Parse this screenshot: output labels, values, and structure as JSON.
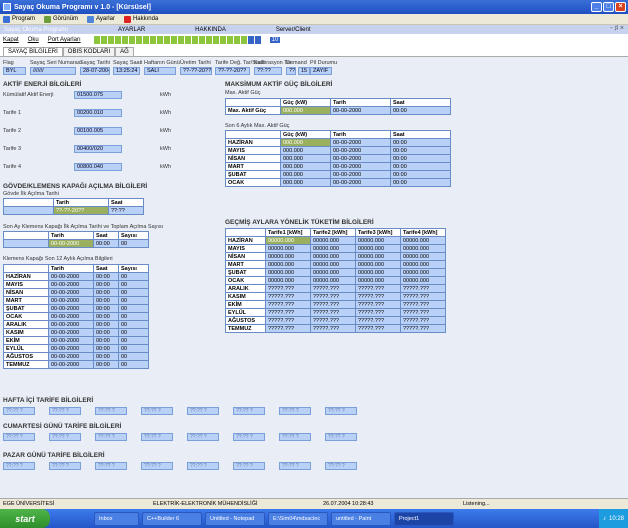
{
  "window": {
    "title": "Sayaç Okuma Programı v 1.0 - [Kürsüsel]"
  },
  "menu": [
    "Program",
    "Görünüm",
    "Ayarlar",
    "Hakkında"
  ],
  "mdi": {
    "child_title": "Sayaç Okuma Programı",
    "items": [
      "AYARLAR",
      "HAKKINDA",
      "Server/Client"
    ],
    "controls": "- ♯ ×"
  },
  "toolbar": {
    "kapat": "Kapat",
    "oku": "Oku",
    "port": "Port Ayarları",
    "progress_label": "10"
  },
  "tabs": [
    "SAYAÇ BİLGİLERİ",
    "OBIS KODLARI",
    "AĞ"
  ],
  "info": {
    "labels": [
      "Flag",
      "Sayaç Seri Numarası",
      "Sayaç Tarihi",
      "Sayaç Saati",
      "Haftanın Günü",
      "Üretim Tarihi",
      "Tarife Değ. Tar/Saati",
      "Kalibrasyon Tar.",
      "Demand",
      "Pil Durumu"
    ],
    "values": [
      "BYL",
      "///////",
      "28-07-2004",
      "13:25:24",
      "SALI",
      "??-??-20??",
      "??-??-20??",
      "??:??",
      "??-??-20??",
      "15",
      "ZAYIF"
    ],
    "dk": "DK"
  },
  "aktif": {
    "title": "AKTİF ENERJİ BİLGİLERİ",
    "rows": [
      {
        "label": "Kümülatif Aktif Enerji",
        "value": "01500.075",
        "unit": "kWh"
      },
      {
        "label": "Tarife 1",
        "value": "00200.010",
        "unit": "kWh"
      },
      {
        "label": "Tarife 2",
        "value": "00100.005",
        "unit": "kWh"
      },
      {
        "label": "Tarife 3",
        "value": "00400/020",
        "unit": "kWh"
      },
      {
        "label": "Tarife 4",
        "value": "00800.040",
        "unit": "kWh"
      }
    ]
  },
  "govde": {
    "title": "GÖVDE/KLEMENS KAPAĞI AÇILMA BİLGİLERİ",
    "sub1": "Gövde İlk Açılma Tarihi",
    "head1": [
      "Tarih",
      "Saat"
    ],
    "row1": [
      "??-??-20??",
      "??:??"
    ],
    "sub2": "Son Ay Klemens Kapağı İlk Açılma Tarihi ve Toplam Açılma Sayısı",
    "head2": [
      "Tarih",
      "Saat",
      "Sayısı"
    ],
    "row2": [
      "00-00-2000",
      "00:00",
      "00"
    ],
    "sub3": "Klemens Kapağı Son 12 Aylık Açılma Bilgileri",
    "head3": [
      "Tarih",
      "Saat",
      "Sayısı"
    ],
    "months": [
      "HAZİRAN",
      "MAYIS",
      "NİSAN",
      "MART",
      "ŞUBAT",
      "OCAK",
      "ARALIK",
      "KASIM",
      "EKİM",
      "EYLÜL",
      "AĞUSTOS",
      "TEMMUZ"
    ],
    "cells": [
      "00-00-2000",
      "00:00",
      "00"
    ]
  },
  "maks": {
    "title": "MAKSİMUM AKTİF GÜÇ BİLGİLERİ",
    "sub1": "Max. Aktif Güç",
    "head": [
      "Güç (kW)",
      "Tarih",
      "Saat"
    ],
    "row1": {
      "label": "Max. Aktif Güç",
      "values": [
        "000.000",
        "00-00-2000",
        "00:00"
      ]
    },
    "sub2": "Son 6 Aylık Max. Aktif Güç",
    "months": [
      "HAZİRAN",
      "MAYIS",
      "NİSAN",
      "MART",
      "ŞUBAT",
      "OCAK"
    ],
    "cells": [
      "000.000",
      "00-00-2000",
      "00:00"
    ]
  },
  "gecmis": {
    "title": "GEÇMİŞ AYLARA YÖNELİK TÜKETİM BİLGİLERİ",
    "head": [
      "Tarife1 [kWh]",
      "Tarife2 [kWh]",
      "Tarife3 [kWh]",
      "Tarife4 [kWh]"
    ],
    "rows": [
      {
        "m": "HAZİRAN",
        "v": [
          "00000.000",
          "00000.000",
          "00000.000",
          "00000.000"
        ]
      },
      {
        "m": "MAYIS",
        "v": [
          "00000.000",
          "00000.000",
          "00000.000",
          "00000.000"
        ]
      },
      {
        "m": "NİSAN",
        "v": [
          "00000.000",
          "00000.000",
          "00000.000",
          "00000.000"
        ]
      },
      {
        "m": "MART",
        "v": [
          "00000.000",
          "00000.000",
          "00000.000",
          "00000.000"
        ]
      },
      {
        "m": "ŞUBAT",
        "v": [
          "00000.000",
          "00000.000",
          "00000.000",
          "00000.000"
        ]
      },
      {
        "m": "OCAK",
        "v": [
          "00000.000",
          "00000.000",
          "00000.000",
          "00000.000"
        ]
      },
      {
        "m": "ARALIK",
        "v": [
          "?????.???",
          "?????.???",
          "?????.???",
          "?????.???"
        ]
      },
      {
        "m": "KASIM",
        "v": [
          "?????.???",
          "?????.???",
          "?????.???",
          "?????.???"
        ]
      },
      {
        "m": "EKİM",
        "v": [
          "?????.???",
          "?????.???",
          "?????.???",
          "?????.???"
        ]
      },
      {
        "m": "EYLÜL",
        "v": [
          "?????.???",
          "?????.???",
          "?????.???",
          "?????.???"
        ]
      },
      {
        "m": "AĞUSTOS",
        "v": [
          "?????.???",
          "?????.???",
          "?????.???",
          "?????.???"
        ]
      },
      {
        "m": "TEMMUZ",
        "v": [
          "?????.???",
          "?????.???",
          "?????.???",
          "?????.???"
        ]
      }
    ]
  },
  "tarife": {
    "hafta_ici": "HAFTA İÇİ TARİFE BİLGİLERİ",
    "cumartesi": "CUMARTESİ GÜNÜ TARİFE BİLGİLERİ",
    "pazar": "PAZAR GÜNÜ TARİFE BİLGİLERİ",
    "slot": "??:?? ?"
  },
  "status": [
    "EGE ÜNİVERSİTESİ",
    "ELEKTRİK-ELEKTRONİK MÜHENDİSLİĞİ",
    "26.07.2004 10:28:43",
    "Listening..."
  ],
  "taskbar": {
    "start": "start",
    "tasks": [
      "Inbox",
      "C++Builder 6",
      "Untitled - Notepad",
      "E:\\Sim04\\mdsaclec",
      "untitled - Paint",
      "Project1"
    ],
    "clock": "10:28"
  }
}
